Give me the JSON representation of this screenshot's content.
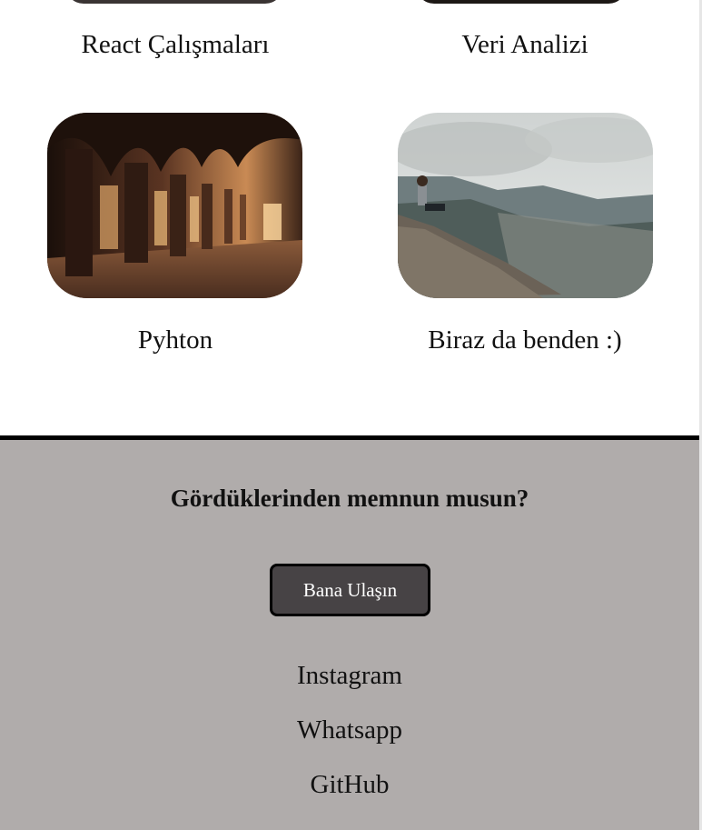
{
  "projects": [
    {
      "title": "React Çalışmaları",
      "image_icon": "project-image"
    },
    {
      "title": "Veri Analizi",
      "image_icon": "project-image"
    },
    {
      "title": "Pyhton",
      "image_icon": "arched-corridor-image"
    },
    {
      "title": "Biraz da benden :)",
      "image_icon": "mountain-view-image"
    }
  ],
  "footer": {
    "question": "Gördüklerinden memnun musun?",
    "contact_button": "Bana Ulaşın",
    "links": [
      "Instagram",
      "Whatsapp",
      "GitHub"
    ],
    "background_color": "#b0acab",
    "button_color": "#474345"
  }
}
